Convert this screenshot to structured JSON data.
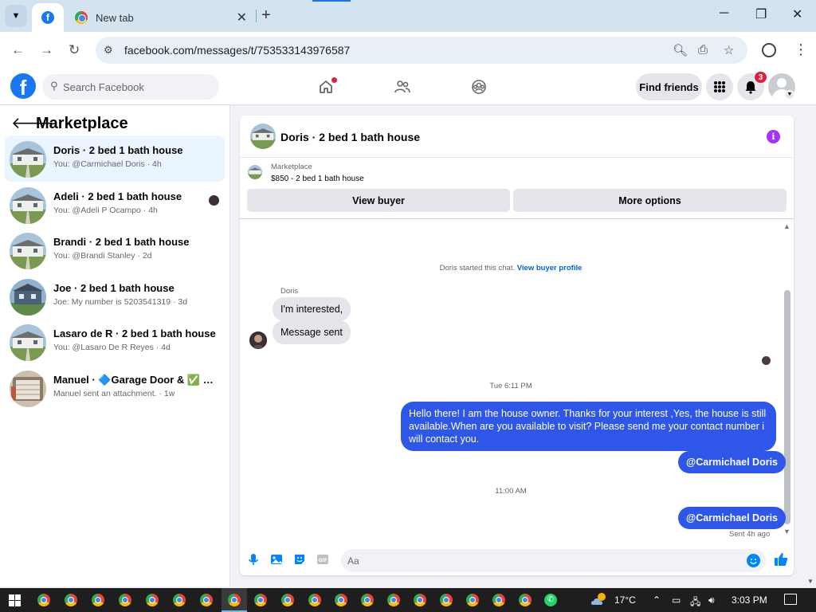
{
  "browser": {
    "tabs": [
      {
        "label": "",
        "favicon": "facebook-icon",
        "active": true
      },
      {
        "label": "New tab",
        "favicon": "chrome-icon",
        "active": false
      }
    ],
    "url": "facebook.com/messages/t/753533143976587"
  },
  "fb_header": {
    "search_placeholder": "Search Facebook",
    "find_friends_label": "Find friends",
    "notification_count": "3",
    "accent_color": "#1877f2"
  },
  "left_panel": {
    "title": "Marketplace",
    "conversations": [
      {
        "title": "Doris · 2 bed 1 bath house",
        "subtitle": "You: @Carmichael Doris · 4h",
        "selected": true
      },
      {
        "title": "Adeli · 2 bed 1 bath house",
        "subtitle": "You: @Adeli P Ocampo · 4h",
        "selected": false
      },
      {
        "title": "Brandi · 2 bed 1 bath house",
        "subtitle": "You: @Brandi Stanley · 2d",
        "selected": false
      },
      {
        "title": "Joe · 2 bed 1 bath house",
        "subtitle": "Joe: My number is 5203541319 · 3d",
        "selected": false
      },
      {
        "title": "Lasaro de R · 2 bed 1 bath house",
        "subtitle": "You: @Lasaro De R Reyes · 4d",
        "selected": false
      },
      {
        "title": "Manuel · 🔷Garage Door & ✅ Gar...",
        "subtitle": "Manuel sent an attachment. · 1w",
        "selected": false
      }
    ]
  },
  "chat": {
    "title": "Doris · 2 bed 1 bath house",
    "listing_label": "Marketplace",
    "listing_detail": "$850 - 2 bed 1 bath house",
    "view_buyer_label": "View buyer",
    "more_options_label": "More options",
    "started_note": "Doris started this chat.",
    "started_link": "View buyer profile",
    "sender_name": "Doris",
    "incoming": [
      "I'm interested,",
      "Message sent"
    ],
    "timestamp_1": "Tue 6:11 PM",
    "outgoing_long": "Hello there! I am the house owner. Thanks for your interest ,Yes, the house is still available.When are you available to visit? Please send me your contact number i will contact you.",
    "outgoing_mention_1": "@Carmichael Doris",
    "timestamp_2": "11:00 AM",
    "outgoing_mention_2": "@Carmichael Doris",
    "sent_status": "Sent 4h ago",
    "composer_placeholder": "Aa",
    "bubble_color": "#2e56e8"
  },
  "taskbar": {
    "temperature": "17°C",
    "time": "3:03 PM"
  }
}
